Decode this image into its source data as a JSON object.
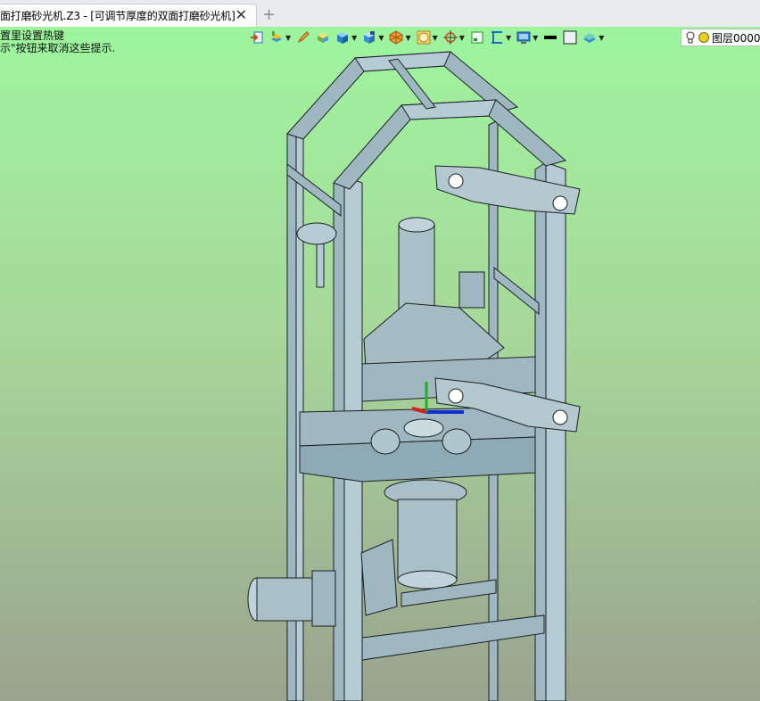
{
  "tab": {
    "title": "面打磨砂光机.Z3 - [可调节厚度的双面打磨砂光机]",
    "close_icon": "close-icon",
    "add_icon": "plus-icon"
  },
  "hint": {
    "line1": "置里设置热键",
    "line2": "示\"按钮来取消这些提示."
  },
  "toolbar": {
    "layer_name": "图层0000",
    "icons": [
      "import-icon",
      "layer-tools-icon",
      "pencil-icon",
      "cube-face-icon",
      "solid-cube-icon",
      "shape-cube-icon",
      "explode-icon",
      "circle-frame-icon",
      "pivot-icon",
      "frame-icon",
      "dimension-icon",
      "display-icon",
      "line-color-icon",
      "fill-color-icon",
      "layers-icon",
      "bulb-icon",
      "layer-color-icon"
    ]
  },
  "colors": {
    "viewport_top": "#9ef59e",
    "viewport_bottom": "#9aa38e",
    "model_fill": "#9fb7c0",
    "model_edge": "#1a1f22"
  }
}
